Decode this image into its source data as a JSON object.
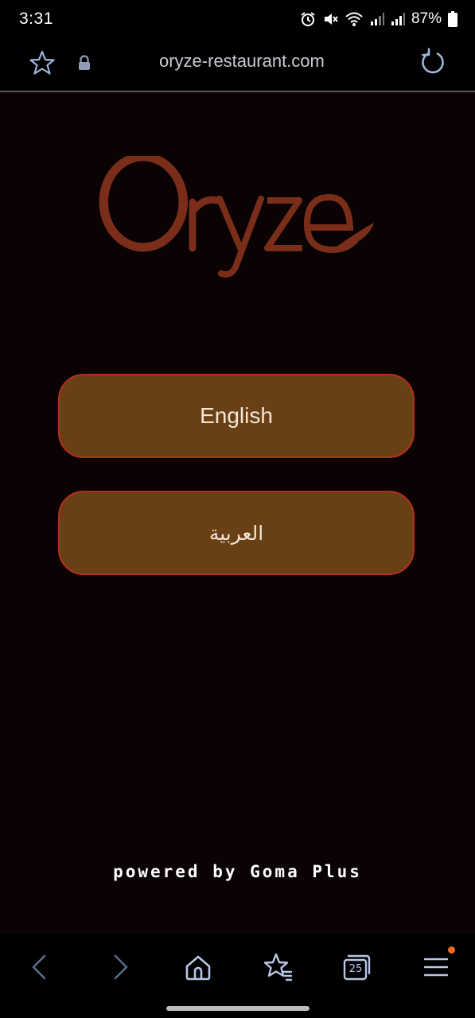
{
  "status_bar": {
    "time": "3:31",
    "battery": "87%",
    "icons": [
      "alarm-icon",
      "mute-icon",
      "wifi-icon",
      "signal-icon",
      "signal-icon",
      "battery-icon"
    ]
  },
  "browser": {
    "url": "oryze-restaurant.com"
  },
  "page": {
    "logo_text": "Oryze",
    "languages": [
      {
        "label": "English"
      },
      {
        "label": "العربية"
      }
    ],
    "footer": "powered by Goma Plus"
  },
  "bottom_nav": {
    "tab_count": "25",
    "items": [
      "back-icon",
      "forward-icon",
      "home-icon",
      "bookmarks-icon",
      "tabs-icon",
      "menu-icon"
    ]
  },
  "colors": {
    "background": "#0b0204",
    "button_fill": "#693f16",
    "button_border": "#b3301f",
    "logo": "#7a2e1a",
    "notification": "#f06a25"
  }
}
